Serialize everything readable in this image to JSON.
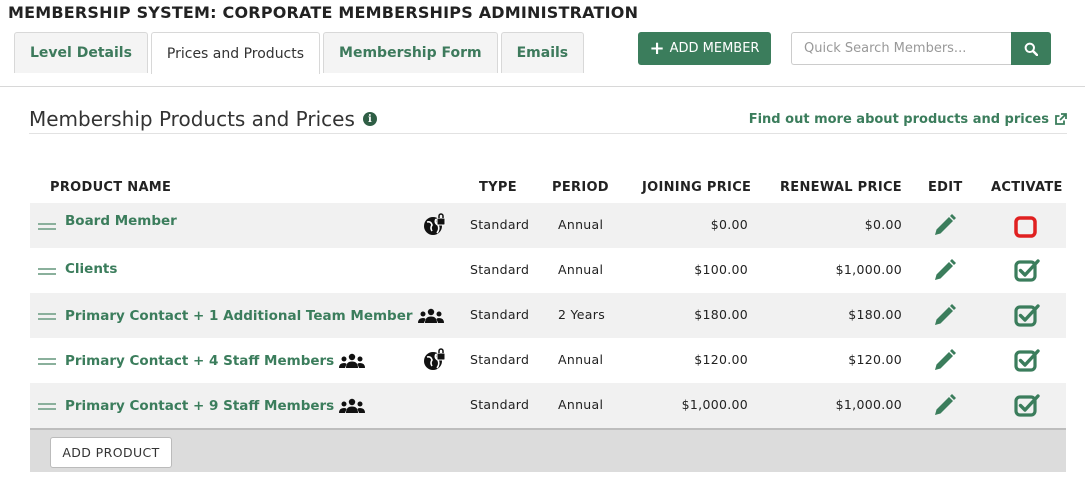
{
  "page_title": "MEMBERSHIP SYSTEM: CORPORATE MEMBERSHIPS ADMINISTRATION",
  "tabs": [
    {
      "label": "Level Details",
      "active": false
    },
    {
      "label": "Prices and Products",
      "active": true
    },
    {
      "label": "Membership Form",
      "active": false
    },
    {
      "label": "Emails",
      "active": false
    }
  ],
  "toolbar": {
    "add_member_label": "ADD MEMBER",
    "search_placeholder": "Quick Search Members...",
    "search_value": ""
  },
  "section": {
    "title": "Membership Products and Prices",
    "find_more_link": "Find out more about products and prices"
  },
  "table": {
    "headers": {
      "product_name": "PRODUCT NAME",
      "type": "TYPE",
      "period": "PERIOD",
      "joining_price": "JOINING PRICE",
      "renewal_price": "RENEWAL PRICE",
      "edit": "EDIT",
      "activate": "ACTIVATE"
    },
    "rows": [
      {
        "name": "Board Member",
        "type": "Standard",
        "period": "Annual",
        "joining": "$0.00",
        "renewal": "$0.00",
        "group_icon": false,
        "restricted_icon": true,
        "active": false
      },
      {
        "name": "Clients",
        "type": "Standard",
        "period": "Annual",
        "joining": "$100.00",
        "renewal": "$1,000.00",
        "group_icon": false,
        "restricted_icon": false,
        "active": true
      },
      {
        "name": "Primary Contact + 1 Additional Team Member",
        "type": "Standard",
        "period": "2 Years",
        "joining": "$180.00",
        "renewal": "$180.00",
        "group_icon": true,
        "restricted_icon": false,
        "active": true
      },
      {
        "name": "Primary Contact + 4 Staff Members",
        "type": "Standard",
        "period": "Annual",
        "joining": "$120.00",
        "renewal": "$120.00",
        "group_icon": true,
        "restricted_icon": true,
        "active": true
      },
      {
        "name": "Primary Contact + 9 Staff Members",
        "type": "Standard",
        "period": "Annual",
        "joining": "$1,000.00",
        "renewal": "$1,000.00",
        "group_icon": true,
        "restricted_icon": false,
        "active": true
      }
    ]
  },
  "footer": {
    "add_product_label": "ADD PRODUCT"
  },
  "colors": {
    "brand_green": "#3b7d5c",
    "inactive_red": "#e02020",
    "row_shade": "#f1f1f1"
  },
  "icons": {
    "add": "plus-icon",
    "search": "search-icon",
    "info": "info-icon",
    "external_link": "external-link-icon",
    "drag": "drag-handle-icon",
    "group": "users-group-icon",
    "restricted": "globe-lock-icon",
    "edit": "pencil-icon",
    "active": "checked-box-icon",
    "inactive": "empty-box-icon"
  }
}
